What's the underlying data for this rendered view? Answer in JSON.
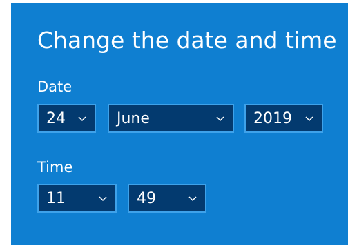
{
  "dialog": {
    "title": "Change the date and time",
    "date_label": "Date",
    "time_label": "Time",
    "day": {
      "value": "24"
    },
    "month": {
      "value": "June"
    },
    "year": {
      "value": "2019"
    },
    "hour": {
      "value": "11"
    },
    "minute": {
      "value": "49"
    }
  },
  "colors": {
    "panel_background": "#0f7fd1",
    "dropdown_background": "#033a6f",
    "dropdown_border": "#3ea2ea",
    "text": "#ffffff"
  },
  "icons": {
    "dropdown": "chevron-down-icon"
  }
}
